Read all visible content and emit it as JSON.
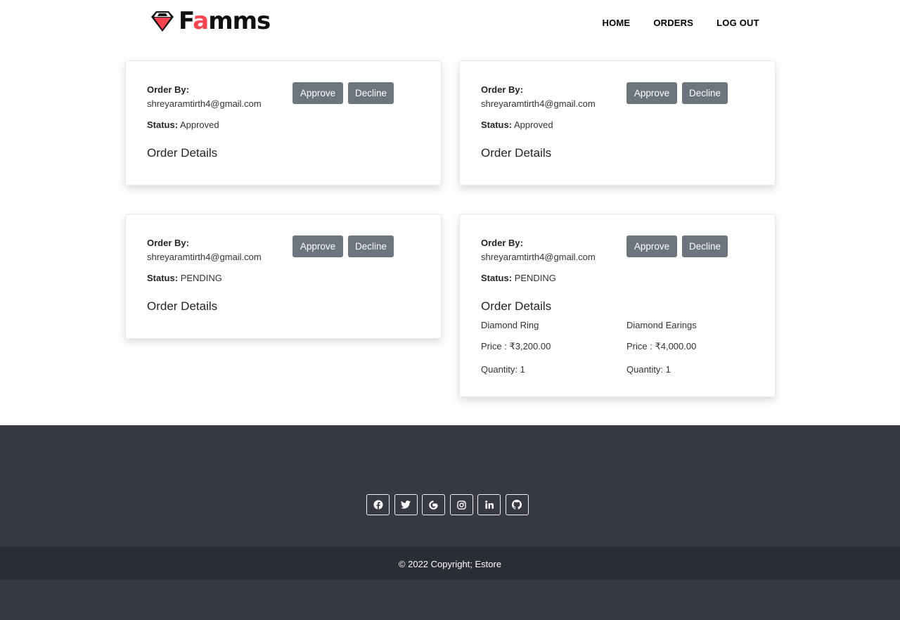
{
  "header": {
    "logo": {
      "text_prefix": "F",
      "text_accent": "a",
      "text_suffix": "mms",
      "icon": "diamond-icon",
      "accent_color": "#f7444e"
    },
    "nav": [
      {
        "label": "HOME"
      },
      {
        "label": "ORDERS"
      },
      {
        "label": "LOG OUT"
      }
    ]
  },
  "orders": [
    {
      "order_by_label": "Order By:",
      "email": "shreyaramtirth4@gmail.com",
      "status_label": "Status:",
      "status": "Approved",
      "approve_label": "Approve",
      "decline_label": "Decline",
      "details_title": "Order Details",
      "items": []
    },
    {
      "order_by_label": "Order By:",
      "email": "shreyaramtirth4@gmail.com",
      "status_label": "Status:",
      "status": "Approved",
      "approve_label": "Approve",
      "decline_label": "Decline",
      "details_title": "Order Details",
      "items": []
    },
    {
      "order_by_label": "Order By:",
      "email": "shreyaramtirth4@gmail.com",
      "status_label": "Status:",
      "status": "PENDING",
      "approve_label": "Approve",
      "decline_label": "Decline",
      "details_title": "Order Details",
      "items": []
    },
    {
      "order_by_label": "Order By:",
      "email": "shreyaramtirth4@gmail.com",
      "status_label": "Status:",
      "status": "PENDING",
      "approve_label": "Approve",
      "decline_label": "Decline",
      "details_title": "Order Details",
      "items": [
        {
          "name": "Diamond Ring",
          "price": "Price : ₹3,200.00",
          "quantity": "Quantity: 1"
        },
        {
          "name": "Diamond Earings",
          "price": "Price : ₹4,000.00",
          "quantity": "Quantity: 1"
        }
      ]
    }
  ],
  "footer": {
    "social_icons": [
      "facebook-icon",
      "twitter-icon",
      "google-icon",
      "instagram-icon",
      "linkedin-icon",
      "github-icon"
    ],
    "copyright": "© 2022 Copyright; Estore"
  },
  "colors": {
    "button": "#6c757d",
    "footer_bg": "#373a43",
    "copyright_bg": "#2a2d33",
    "brand_accent": "#f7444e"
  }
}
